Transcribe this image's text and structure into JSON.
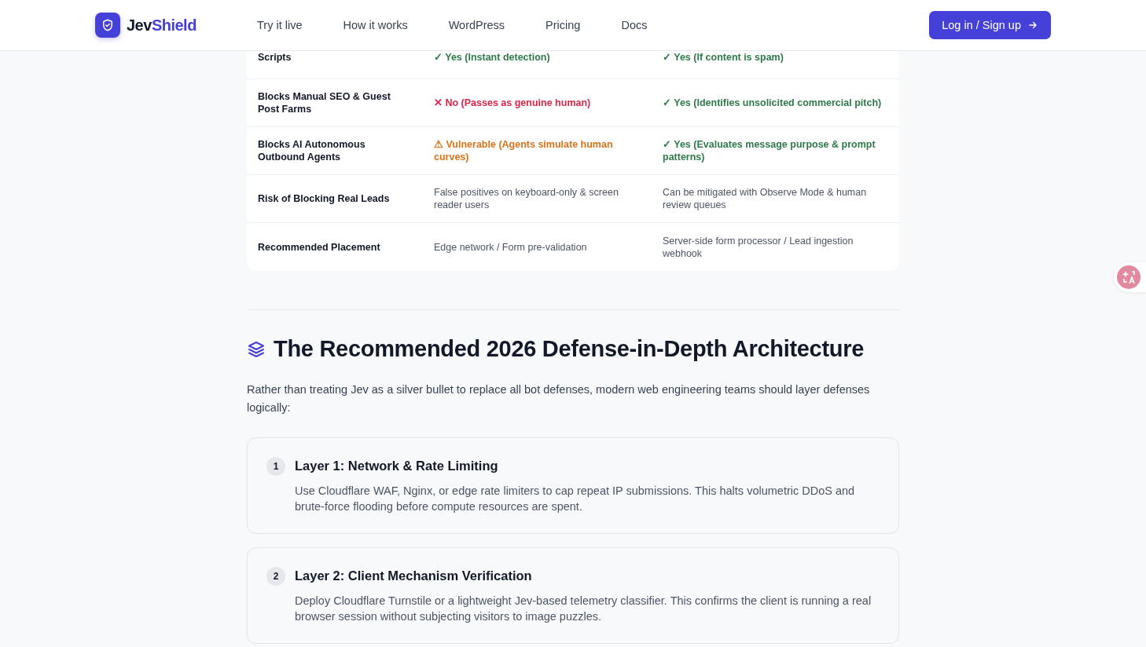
{
  "nav": {
    "logo": {
      "first": "Jev",
      "second": "Shield"
    },
    "links": [
      "Try it live",
      "How it works",
      "WordPress",
      "Pricing",
      "Docs"
    ],
    "cta": "Log in / Sign up"
  },
  "table": {
    "rows": [
      {
        "label": "Scripts",
        "cells": [
          {
            "kind": "yes",
            "text": "✓ Yes (Instant detection)"
          },
          {
            "kind": "yes",
            "text": "✓ Yes (If content is spam)"
          }
        ]
      },
      {
        "label": "Blocks Manual SEO & Guest Post Farms",
        "cells": [
          {
            "kind": "no",
            "text": "✕ No (Passes as genuine human)"
          },
          {
            "kind": "yes",
            "text": "✓ Yes (Identifies unsolicited commercial pitch)"
          }
        ]
      },
      {
        "label": "Blocks AI Autonomous Outbound Agents",
        "cells": [
          {
            "kind": "warn",
            "text": "⚠ Vulnerable (Agents simulate human curves)"
          },
          {
            "kind": "yes",
            "text": "✓ Yes (Evaluates message purpose & prompt patterns)"
          }
        ]
      },
      {
        "label": "Risk of Blocking Real Leads",
        "cells": [
          {
            "kind": "plain",
            "text": "False positives on keyboard-only & screen reader users"
          },
          {
            "kind": "plain",
            "text": "Can be mitigated with Observe Mode & human review queues"
          }
        ]
      },
      {
        "label": "Recommended Placement",
        "cells": [
          {
            "kind": "plain",
            "text": "Edge network / Form pre-validation"
          },
          {
            "kind": "plain",
            "text": "Server-side form processor / Lead ingestion webhook"
          }
        ]
      }
    ]
  },
  "section": {
    "title": "The Recommended 2026 Defense-in-Depth Architecture",
    "intro": "Rather than treating Jev as a silver bullet to replace all bot defenses, modern web engineering teams should layer defenses logically:",
    "layers": [
      {
        "number": "1",
        "title": "Layer 1: Network & Rate Limiting",
        "text": "Use Cloudflare WAF, Nginx, or edge rate limiters to cap repeat IP submissions. This halts volumetric DDoS and brute-force flooding before compute resources are spent."
      },
      {
        "number": "2",
        "title": "Layer 2: Client Mechanism Verification",
        "text": "Deploy Cloudflare Turnstile or a lightweight Jev-based telemetry classifier. This confirms the client is running a real browser session without subjecting visitors to image puzzles."
      }
    ]
  }
}
